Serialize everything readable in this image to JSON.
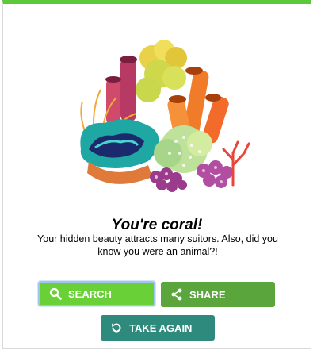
{
  "result": {
    "title": "You're coral!",
    "description": "Your hidden beauty attracts many suitors. Also, did you know you were an animal?!"
  },
  "buttons": {
    "search": {
      "label": "SEARCH",
      "icon": "search-icon",
      "color": "#6ad037"
    },
    "share": {
      "label": "SHARE",
      "icon": "share-icon",
      "color": "#5aa53c"
    },
    "take_again": {
      "label": "TAKE AGAIN",
      "icon": "refresh-icon",
      "color": "#2e8a7c"
    }
  },
  "accent_color": "#5cc93b"
}
